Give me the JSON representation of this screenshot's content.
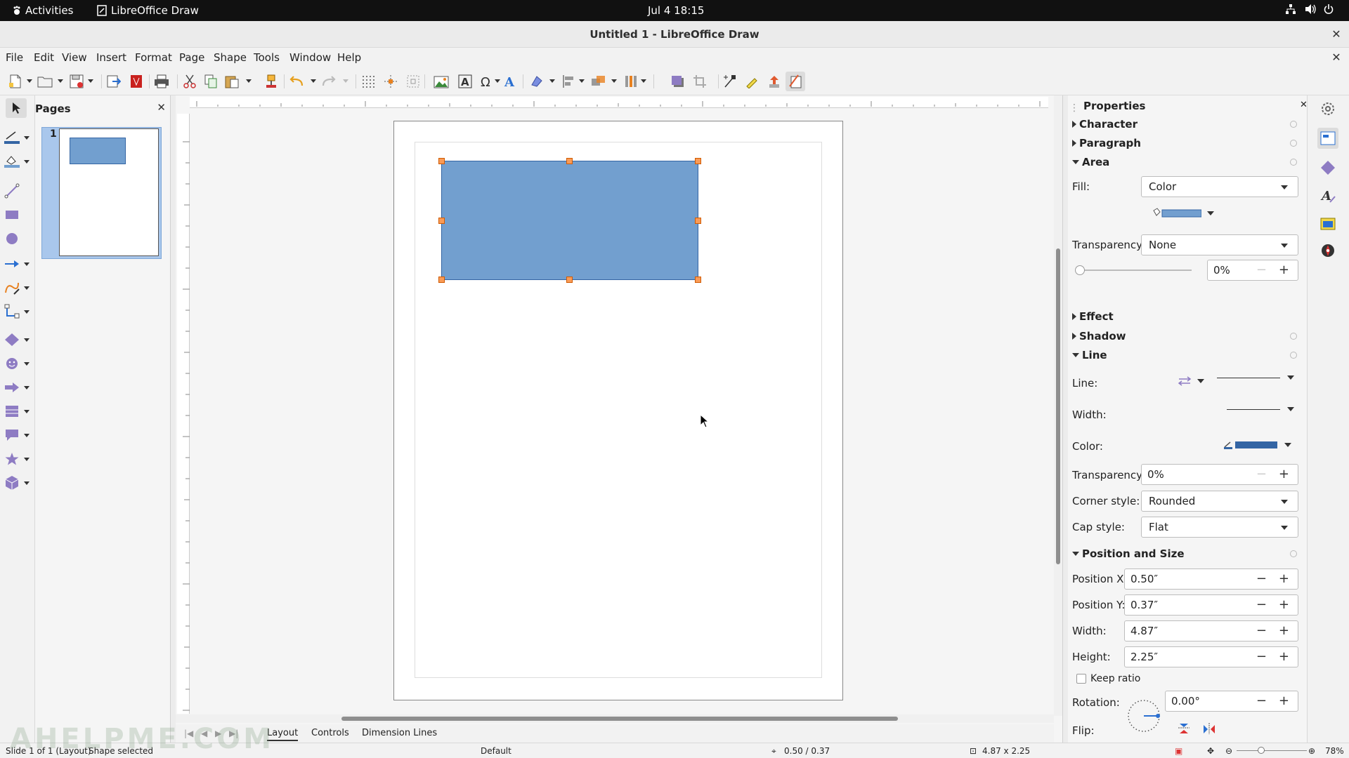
{
  "system": {
    "activities": "Activities",
    "app": "LibreOffice Draw",
    "clock": "Jul 4  18:15"
  },
  "window": {
    "title": "Untitled 1 - LibreOffice Draw",
    "close": "✕"
  },
  "menu": [
    "File",
    "Edit",
    "View",
    "Insert",
    "Format",
    "Page",
    "Shape",
    "Tools",
    "Window",
    "Help"
  ],
  "pages_pane": {
    "title": "Pages",
    "close": "✕",
    "page_number": "1"
  },
  "layout_tabs": [
    "Layout",
    "Controls",
    "Dimension Lines"
  ],
  "properties": {
    "title": "Properties",
    "close": "✕",
    "sections": {
      "character": "Character",
      "paragraph": "Paragraph",
      "area": "Area",
      "effect": "Effect",
      "shadow": "Shadow",
      "line": "Line",
      "possize": "Position and Size"
    },
    "area": {
      "fill_label": "Fill:",
      "fill_value": "Color",
      "transparency_label": "Transparency:",
      "transparency_value": "None",
      "transparency_pct": "0%"
    },
    "line": {
      "line_label": "Line:",
      "width_label": "Width:",
      "color_label": "Color:",
      "transparency_label": "Transparency:",
      "transparency_value": "0%",
      "corner_label": "Corner style:",
      "corner_value": "Rounded",
      "cap_label": "Cap style:",
      "cap_value": "Flat"
    },
    "possize": {
      "posx_label": "Position X:",
      "posx": "0.50″",
      "posy_label": "Position Y:",
      "posy": "0.37″",
      "width_label": "Width:",
      "width": "4.87″",
      "height_label": "Height:",
      "height": "2.25″",
      "keep_ratio": "Keep ratio",
      "rotation_label": "Rotation:",
      "rotation": "0.00°",
      "flip_label": "Flip:"
    }
  },
  "colors": {
    "fill": "#729fcf",
    "line": "#3465a4",
    "handle": "#f99b57"
  },
  "status": {
    "slide": "Slide 1 of 1 (Layout)",
    "selection": "Shape selected",
    "style": "Default",
    "position": "0.50 / 0.37",
    "size": "4.87 x 2.25",
    "zoom": "78%"
  },
  "watermark": "AHELPME.COM"
}
